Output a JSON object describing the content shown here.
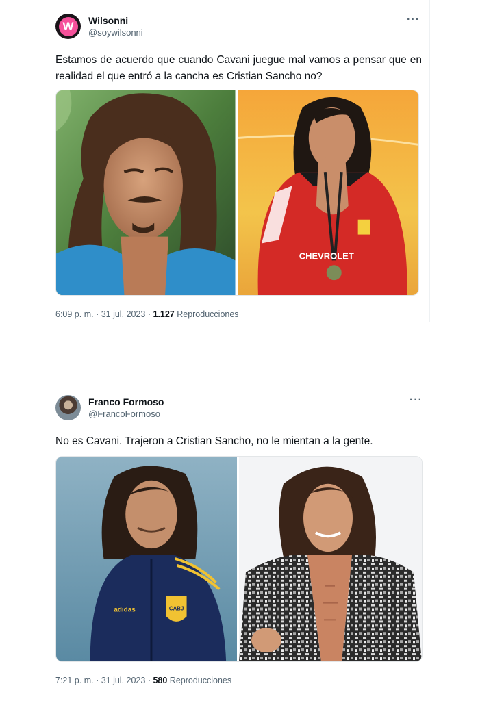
{
  "tweets": [
    {
      "display_name": "Wilsonni",
      "handle": "@soywilsonni",
      "avatar_letter": "W",
      "more_label": "···",
      "text": "Estamos de acuerdo que cuando Cavani juegue mal vamos a pensar que en realidad el que entró a la cancha es Cristian Sancho no?",
      "time": "6:09 p. m.",
      "separator": " · ",
      "date": "31 jul. 2023",
      "views": "1.127",
      "views_label": "Reproducciones",
      "shirt_text": "CHEVROLET"
    },
    {
      "display_name": "Franco Formoso",
      "handle": "@FrancoFormoso",
      "more_label": "···",
      "text": "No es Cavani. Trajeron a Cristian Sancho, no le mientan a la gente.",
      "time": "7:21 p. m.",
      "separator": " · ",
      "date": "31 jul. 2023",
      "views": "580",
      "views_label": "Reproducciones",
      "badge_text": "CABJ",
      "brand_text": "adidas"
    }
  ]
}
